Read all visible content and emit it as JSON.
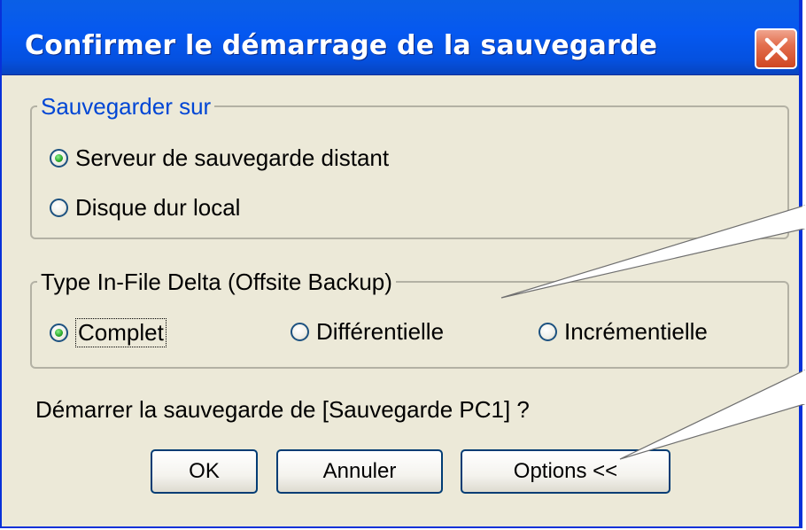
{
  "dialog": {
    "title": "Confirmer le démarrage de la sauvegarde",
    "close_icon": "close-x-icon",
    "accent": "#0558f0"
  },
  "destination": {
    "legend": "Sauvegarder sur",
    "options": [
      {
        "label": "Serveur de sauvegarde distant",
        "checked": true
      },
      {
        "label": "Disque dur local",
        "checked": false
      }
    ]
  },
  "backup_type": {
    "legend": "Type In-File Delta (Offsite Backup)",
    "options": [
      {
        "label": "Complet",
        "checked": true
      },
      {
        "label": "Différentielle",
        "checked": false
      },
      {
        "label": "Incrémentielle",
        "checked": false
      }
    ]
  },
  "prompt": "Démarrer la sauvegarde de [Sauvegarde PC1] ?",
  "buttons": {
    "ok": "OK",
    "cancel": "Annuler",
    "options": "Options <<"
  }
}
